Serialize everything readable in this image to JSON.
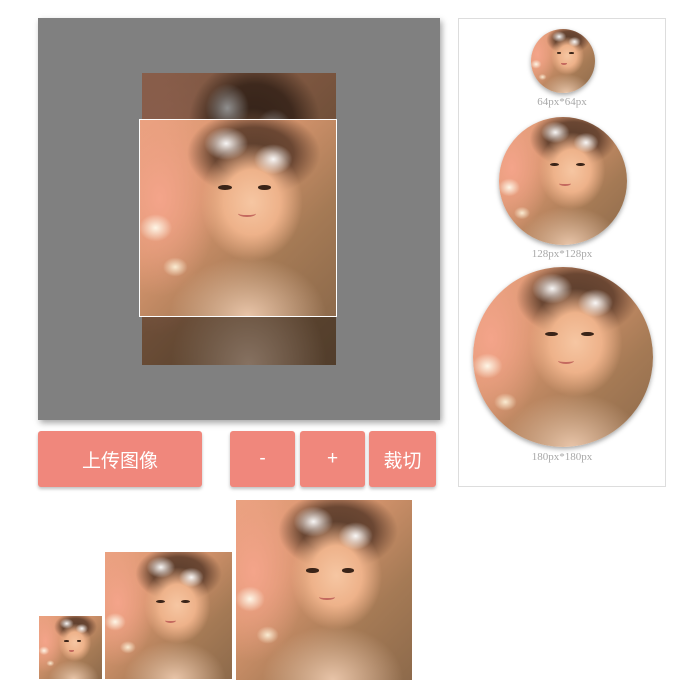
{
  "cropper": {
    "image_alt": "portrait photo"
  },
  "toolbar": {
    "upload_label": "上传图像",
    "zoom_out_label": "-",
    "zoom_in_label": "+",
    "crop_label": "裁切"
  },
  "previews": {
    "circles": [
      {
        "label": "64px*64px"
      },
      {
        "label": "128px*128px"
      },
      {
        "label": "180px*180px"
      }
    ]
  },
  "colors": {
    "button_bg": "#f0877c",
    "cropper_bg": "#808080",
    "label_text": "#a8a8a8"
  }
}
